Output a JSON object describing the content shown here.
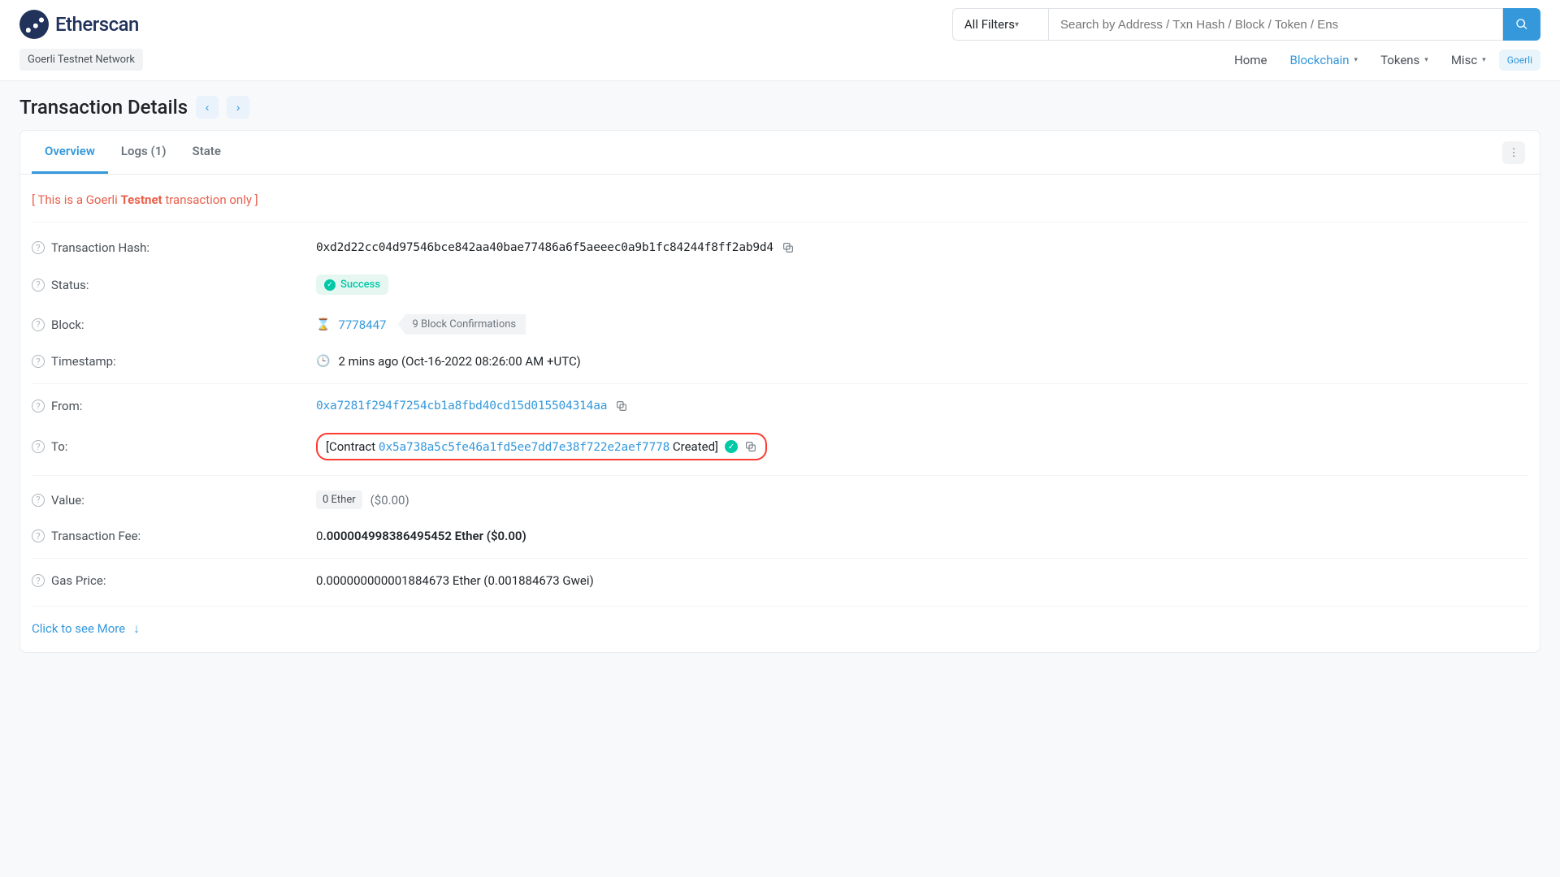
{
  "brand": {
    "name": "Etherscan"
  },
  "search": {
    "filter_label": "All Filters",
    "placeholder": "Search by Address / Txn Hash / Block / Token / Ens"
  },
  "network_badge": "Goerli Testnet Network",
  "nav": {
    "home": "Home",
    "blockchain": "Blockchain",
    "tokens": "Tokens",
    "misc": "Misc",
    "goerli": "Goerli"
  },
  "page": {
    "title": "Transaction Details"
  },
  "tabs": {
    "overview": "Overview",
    "logs": "Logs (1)",
    "state": "State"
  },
  "warning": {
    "prefix": "[ This is a Goerli ",
    "bold": "Testnet",
    "suffix": " transaction only ]"
  },
  "tx": {
    "hash_label": "Transaction Hash:",
    "hash": "0xd2d22cc04d97546bce842aa40bae77486a6f5aeeec0a9b1fc84244f8ff2ab9d4",
    "status_label": "Status:",
    "status_value": "Success",
    "block_label": "Block:",
    "block_number": "7778447",
    "block_confirmations": "9 Block Confirmations",
    "timestamp_label": "Timestamp:",
    "timestamp_value": "2 mins ago (Oct-16-2022 08:26:00 AM +UTC)",
    "from_label": "From:",
    "from_address": "0xa7281f294f7254cb1a8fbd40cd15d015504314aa",
    "to_label": "To:",
    "to_contract_prefix": "[Contract ",
    "to_contract_address": "0x5a738a5c5fe46a1fd5ee7dd7e38f722e2aef7778",
    "to_contract_suffix": " Created]",
    "value_label": "Value:",
    "value_pill": "0 Ether",
    "value_usd": "($0.00)",
    "fee_label": "Transaction Fee:",
    "fee_lead": "0",
    "fee_rest": ".000004998386495452 Ether ($0.00)",
    "gas_label": "Gas Price:",
    "gas_lead": "0",
    "gas_rest": ".000000000001884673 Ether (0.001884673 Gwei)",
    "see_more": "Click to see More"
  }
}
